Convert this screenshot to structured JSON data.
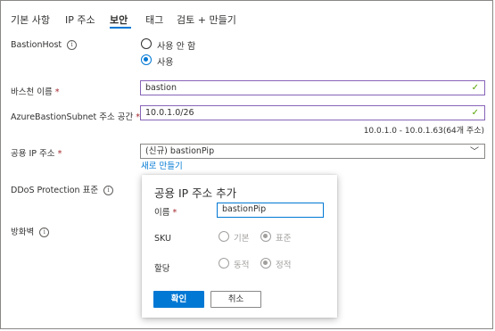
{
  "tabs": [
    {
      "label": "기본 사항",
      "active": false
    },
    {
      "label": "IP 주소",
      "active": false
    },
    {
      "label": "보안",
      "active": true
    },
    {
      "label": "태그",
      "active": false
    },
    {
      "label": "검토 + 만들기",
      "active": false
    }
  ],
  "bastion_host": {
    "label": "BastionHost",
    "options": [
      "사용 안 함",
      "사용"
    ],
    "selected": "사용"
  },
  "bastion_name": {
    "label": "바스천 이름",
    "required_mark": "*",
    "value": "bastion"
  },
  "subnet": {
    "label": "AzureBastionSubnet 주소 공간",
    "required_mark": "*",
    "value": "10.0.1.0/26",
    "hint": "10.0.1.0 - 10.0.1.63(64개 주소)"
  },
  "public_ip": {
    "label": "공용 IP 주소",
    "required_mark": "*",
    "value": "(신규) bastionPip",
    "create_new_link": "새로 만들기"
  },
  "ddos": {
    "label": "DDoS Protection 표준"
  },
  "firewall": {
    "label": "방화벽"
  },
  "popup": {
    "title": "공용 IP 주소 추가",
    "name_label": "이름",
    "required_mark": "*",
    "name_value": "bastionPip",
    "sku_label": "SKU",
    "sku_options": [
      "기본",
      "표준"
    ],
    "sku_selected": "표준",
    "assignment_label": "할당",
    "assignment_options": [
      "동적",
      "정적"
    ],
    "assignment_selected": "정적",
    "ok_label": "확인",
    "cancel_label": "취소"
  },
  "colors": {
    "accent": "#0078d4",
    "valid_border": "#8764b8",
    "check_green": "#57a300",
    "required_red": "#a4262c"
  }
}
